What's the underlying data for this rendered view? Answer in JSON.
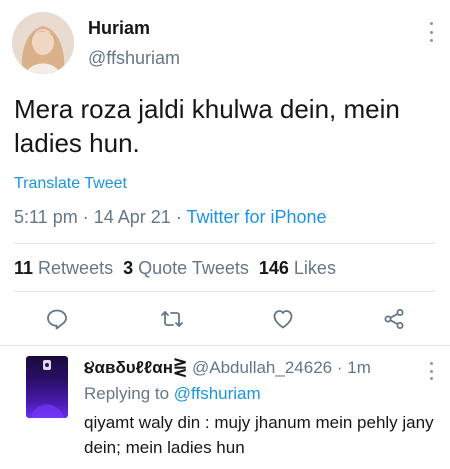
{
  "tweet": {
    "author": {
      "name": "Huriam",
      "handle": "@ffshuriam"
    },
    "text": "Mera roza jaldi khulwa dein, mein ladies hun.",
    "translate_label": "Translate Tweet",
    "time": "5:11 pm",
    "date": "14 Apr 21",
    "source": "Twitter for iPhone",
    "separator": "·",
    "stats": {
      "retweets_count": "11",
      "retweets_label": "Retweets",
      "quotes_count": "3",
      "quotes_label": "Quote Tweets",
      "likes_count": "146",
      "likes_label": "Likes"
    }
  },
  "actions": {
    "icons": [
      "reply-icon",
      "retweet-icon",
      "like-icon",
      "share-icon"
    ]
  },
  "reply": {
    "name": "૪αвδυℓℓαн⋛",
    "handle": "@Abdullah_24626",
    "separator": "·",
    "time": "1m",
    "replying_prefix": "Replying to",
    "replying_to": "@ffshuriam",
    "text": "qiyamt waly din : mujy jhanum mein pehly jany dein; mein ladies hun"
  },
  "colors": {
    "link": "#1b95e0",
    "secondary_text": "#657786",
    "primary_text": "#14171a",
    "divider": "#e1e8ed"
  }
}
